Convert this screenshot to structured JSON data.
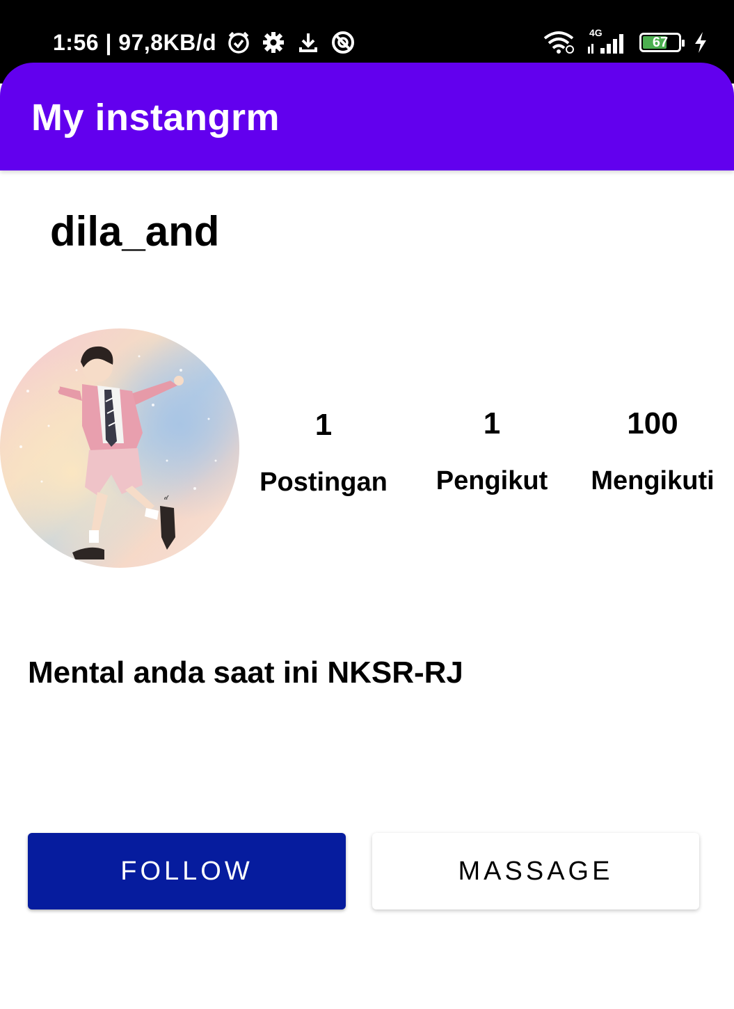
{
  "status_bar": {
    "time_speed": "1:56 | 97,8KB/d",
    "network_type": "4G",
    "battery_level": "67",
    "battery_fraction": 0.67,
    "icons": [
      "alarm-icon",
      "gear-icon",
      "download-icon",
      "no-disturb-icon",
      "wifi-icon",
      "signal-icon",
      "battery-icon",
      "charging-icon"
    ]
  },
  "app_bar": {
    "title": "My instangrm",
    "color": "#6200ee"
  },
  "profile": {
    "username": "dila_and",
    "avatar": "profile-illustration",
    "bio": "Mental anda saat ini NKSR-RJ"
  },
  "stats": [
    {
      "value": "1",
      "label": "Postingan"
    },
    {
      "value": "1",
      "label": "Pengikut"
    },
    {
      "value": "100",
      "label": "Mengikuti"
    }
  ],
  "actions": {
    "follow_label": "FOLLOW",
    "message_label": "MASSAGE",
    "follow_color": "#061c9e"
  }
}
